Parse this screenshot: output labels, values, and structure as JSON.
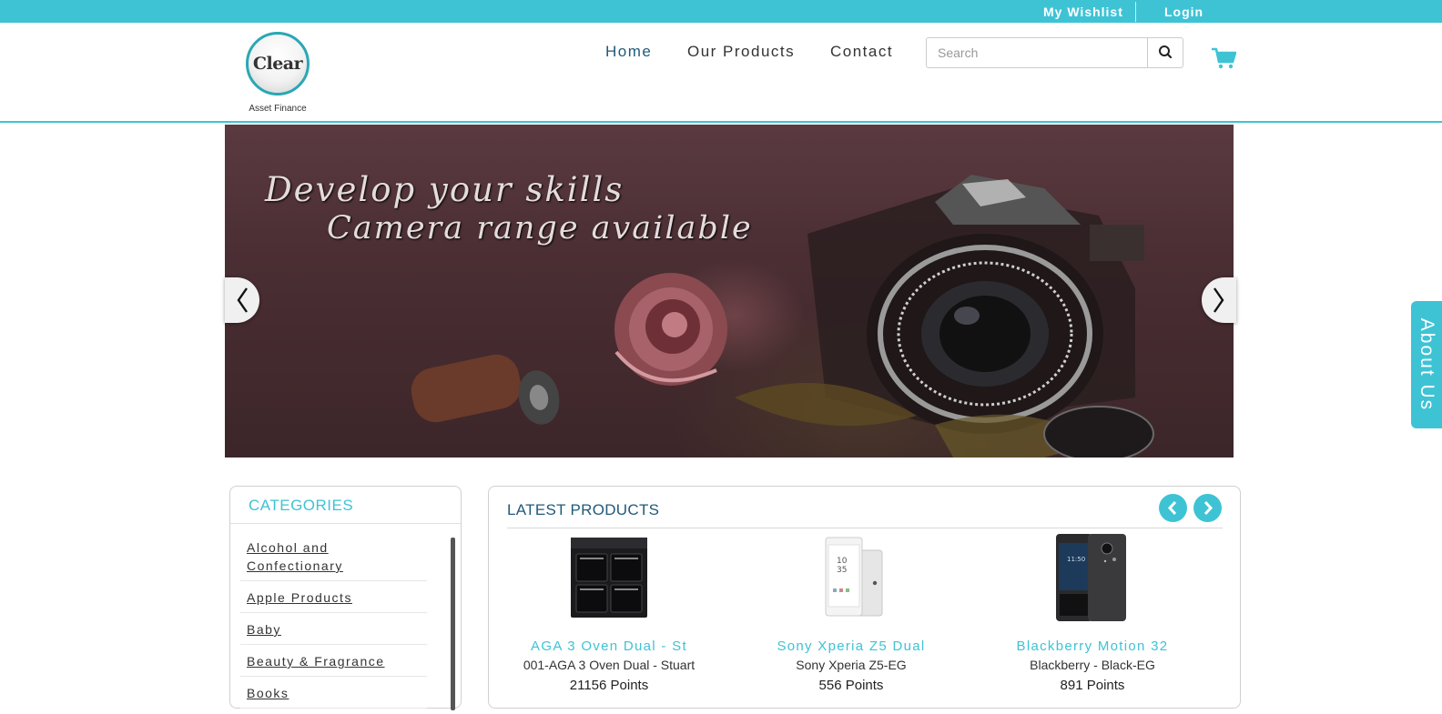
{
  "topbar": {
    "wishlist_label": "My Wishlist",
    "login_label": "Login"
  },
  "header": {
    "logo_word": "Clear",
    "logo_subtitle": "Asset Finance",
    "nav": {
      "home": "Home",
      "products": "Our Products",
      "contact": "Contact"
    },
    "search": {
      "placeholder": "Search",
      "icon": "search-icon"
    },
    "cart_icon": "cart-icon"
  },
  "banner": {
    "line1": "Develop your skills",
    "line2": "Camera range available",
    "prev_icon": "chevron-left-icon",
    "next_icon": "chevron-right-icon"
  },
  "about_tab": "About Us",
  "categories": {
    "title": "CATEGORIES",
    "items": [
      "Alcohol and Confectionary",
      "Apple Products",
      "Baby",
      "Beauty & Fragrance",
      "Books"
    ]
  },
  "latest": {
    "title": "LATEST PRODUCTS",
    "products": [
      {
        "name": "AGA 3 Oven Dual - St",
        "code": "001-AGA 3 Oven Dual - Stuart",
        "points": "21156 Points",
        "image": "oven"
      },
      {
        "name": "Sony Xperia Z5 Dual",
        "code": "Sony Xperia Z5-EG",
        "points": "556 Points",
        "image": "phone-white"
      },
      {
        "name": "Blackberry Motion 32",
        "code": "Blackberry - Black-EG",
        "points": "891 Points",
        "image": "phone-black"
      }
    ]
  },
  "colors": {
    "accent": "#3ec3d5",
    "nav_active": "#205a7a",
    "banner_bg": "#4a2e33"
  }
}
